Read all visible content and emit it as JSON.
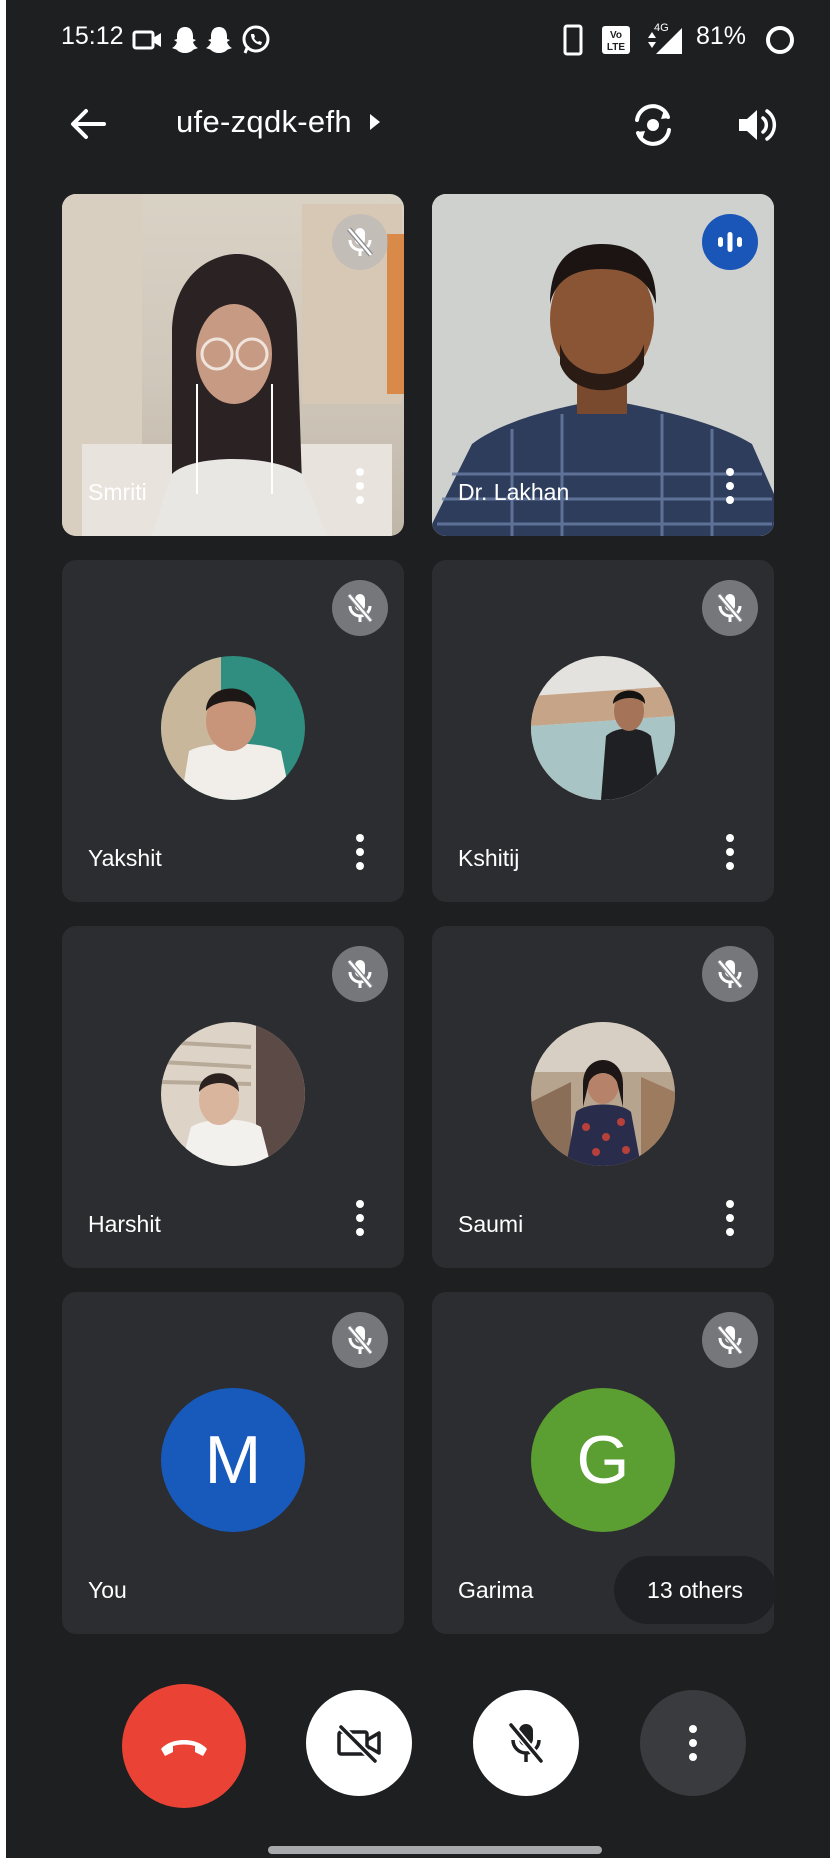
{
  "status_bar": {
    "time": "15:12",
    "network_badge": "4G",
    "battery_percent": "81%",
    "icons": [
      "video-camera-icon",
      "snapchat-icon",
      "snapchat-icon",
      "whatsapp-icon",
      "phone-icon",
      "volte-icon",
      "signal-icon",
      "battery-ring-icon"
    ]
  },
  "app_bar": {
    "meeting_code": "ufe-zqdk-efh",
    "icons": [
      "back-arrow-icon",
      "caret-right-icon",
      "switch-camera-icon",
      "speaker-icon"
    ]
  },
  "participants": [
    {
      "name": "Smriti",
      "type": "video",
      "muted": true
    },
    {
      "name": "Dr. Lakhan",
      "type": "video",
      "speaking": true
    },
    {
      "name": "Yakshit",
      "type": "photo",
      "muted": true
    },
    {
      "name": "Kshitij",
      "type": "photo",
      "muted": true
    },
    {
      "name": "Harshit",
      "type": "photo",
      "muted": true
    },
    {
      "name": "Saumi",
      "type": "photo",
      "muted": true
    },
    {
      "name": "You",
      "type": "initial",
      "initial": "M",
      "color": "#185abc",
      "muted": true
    },
    {
      "name": "Garima",
      "type": "initial",
      "initial": "G",
      "color": "#5b9e31",
      "muted": true
    }
  ],
  "others_badge": "13 others",
  "controls": {
    "end_call_color": "#ea4335",
    "icons": [
      "end-call-icon",
      "camera-off-icon",
      "mic-off-icon",
      "more-vert-icon"
    ]
  },
  "colors": {
    "background": "#1e1f21",
    "tile": "#2c2d30",
    "speaking_badge": "#1a56b8"
  }
}
